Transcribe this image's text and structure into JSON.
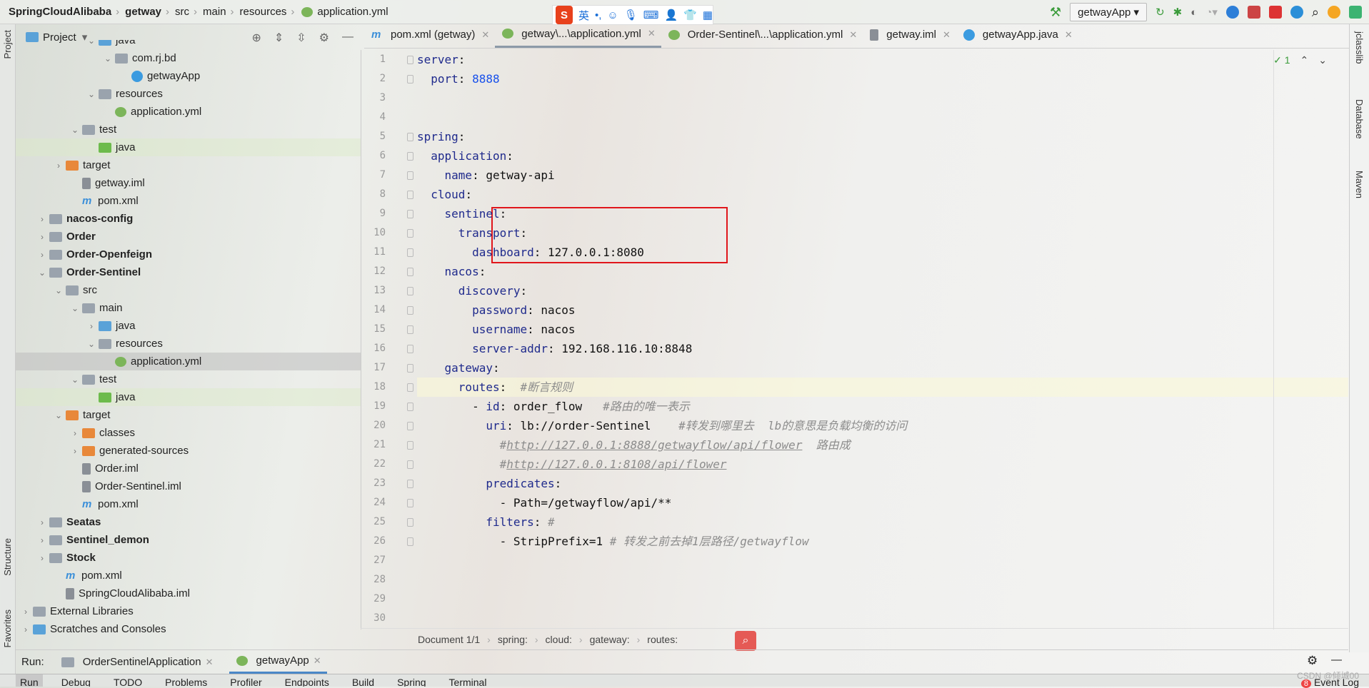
{
  "breadcrumb": [
    "SpringCloudAlibaba",
    "getway",
    "src",
    "main",
    "resources",
    "application.yml"
  ],
  "ime": {
    "logo": "S",
    "lang": "英",
    "punct": "•,"
  },
  "toolbar": {
    "run_config": "getwayApp"
  },
  "left_strip": {
    "project": "Project",
    "structure": "Structure",
    "favorites": "Favorites"
  },
  "right_strip": {
    "classlib": "jclasslib",
    "database": "Database",
    "maven": "Maven"
  },
  "project_panel": {
    "title": "Project",
    "items": [
      {
        "label": "java",
        "level": 4,
        "arrow": "open",
        "icon": "folder-blue"
      },
      {
        "label": "com.rj.bd",
        "level": 5,
        "arrow": "open",
        "icon": "folder-gray"
      },
      {
        "label": "getwayApp",
        "level": 6,
        "icon": "class"
      },
      {
        "label": "resources",
        "level": 4,
        "arrow": "open",
        "icon": "folder-gray"
      },
      {
        "label": "application.yml",
        "level": 5,
        "icon": "yml"
      },
      {
        "label": "test",
        "level": 3,
        "arrow": "open",
        "icon": "folder-gray"
      },
      {
        "label": "java",
        "level": 4,
        "icon": "folder-green",
        "state": "hl"
      },
      {
        "label": "target",
        "level": 2,
        "arrow": "closed",
        "icon": "folder-orange"
      },
      {
        "label": "getway.iml",
        "level": 3,
        "icon": "file"
      },
      {
        "label": "pom.xml",
        "level": 3,
        "icon": "maven"
      },
      {
        "label": "nacos-config",
        "level": 1,
        "arrow": "closed",
        "icon": "folder-gray",
        "bold": true
      },
      {
        "label": "Order",
        "level": 1,
        "arrow": "closed",
        "icon": "folder-gray",
        "bold": true
      },
      {
        "label": "Order-Openfeign",
        "level": 1,
        "arrow": "closed",
        "icon": "folder-gray",
        "bold": true
      },
      {
        "label": "Order-Sentinel",
        "level": 1,
        "arrow": "open",
        "icon": "folder-gray",
        "bold": true
      },
      {
        "label": "src",
        "level": 2,
        "arrow": "open",
        "icon": "folder-gray"
      },
      {
        "label": "main",
        "level": 3,
        "arrow": "open",
        "icon": "folder-gray"
      },
      {
        "label": "java",
        "level": 4,
        "arrow": "closed",
        "icon": "folder-blue"
      },
      {
        "label": "resources",
        "level": 4,
        "arrow": "open",
        "icon": "folder-gray"
      },
      {
        "label": "application.yml",
        "level": 5,
        "icon": "yml",
        "state": "sel"
      },
      {
        "label": "test",
        "level": 3,
        "arrow": "open",
        "icon": "folder-gray"
      },
      {
        "label": "java",
        "level": 4,
        "icon": "folder-green",
        "state": "hl"
      },
      {
        "label": "target",
        "level": 2,
        "arrow": "open",
        "icon": "folder-orange"
      },
      {
        "label": "classes",
        "level": 3,
        "arrow": "closed",
        "icon": "folder-orange"
      },
      {
        "label": "generated-sources",
        "level": 3,
        "arrow": "closed",
        "icon": "folder-orange"
      },
      {
        "label": "Order.iml",
        "level": 3,
        "icon": "file"
      },
      {
        "label": "Order-Sentinel.iml",
        "level": 3,
        "icon": "file"
      },
      {
        "label": "pom.xml",
        "level": 3,
        "icon": "maven"
      },
      {
        "label": "Seatas",
        "level": 1,
        "arrow": "closed",
        "icon": "folder-gray",
        "bold": true
      },
      {
        "label": "Sentinel_demon",
        "level": 1,
        "arrow": "closed",
        "icon": "folder-gray",
        "bold": true
      },
      {
        "label": "Stock",
        "level": 1,
        "arrow": "closed",
        "icon": "folder-gray",
        "bold": true
      },
      {
        "label": "pom.xml",
        "level": 2,
        "icon": "maven"
      },
      {
        "label": "SpringCloudAlibaba.iml",
        "level": 2,
        "icon": "file"
      },
      {
        "label": "External Libraries",
        "level": 0,
        "arrow": "closed",
        "icon": "libraries"
      },
      {
        "label": "Scratches and Consoles",
        "level": 0,
        "arrow": "closed",
        "icon": "scratches"
      }
    ]
  },
  "tabs": [
    {
      "label": "pom.xml (getway)",
      "icon": "maven"
    },
    {
      "label": "getway\\...\\application.yml",
      "icon": "yml",
      "active": true
    },
    {
      "label": "Order-Sentinel\\...\\application.yml",
      "icon": "yml"
    },
    {
      "label": "getway.iml",
      "icon": "file"
    },
    {
      "label": "getwayApp.java",
      "icon": "class"
    }
  ],
  "editor": {
    "inspection": "✓ 1",
    "current_line": 18,
    "lines": [
      [
        [
          "k",
          "server"
        ],
        [
          "v",
          ":"
        ]
      ],
      [
        [
          "v",
          "  "
        ],
        [
          "k",
          "port"
        ],
        [
          "v",
          ": "
        ],
        [
          "n",
          "8888"
        ]
      ],
      [],
      [],
      [
        [
          "k",
          "spring"
        ],
        [
          "v",
          ":"
        ]
      ],
      [
        [
          "v",
          "  "
        ],
        [
          "k",
          "application"
        ],
        [
          "v",
          ":"
        ]
      ],
      [
        [
          "v",
          "    "
        ],
        [
          "k",
          "name"
        ],
        [
          "v",
          ": getway-api"
        ]
      ],
      [
        [
          "v",
          "  "
        ],
        [
          "k",
          "cloud"
        ],
        [
          "v",
          ":"
        ]
      ],
      [
        [
          "v",
          "    "
        ],
        [
          "k",
          "sentinel"
        ],
        [
          "v",
          ":"
        ]
      ],
      [
        [
          "v",
          "      "
        ],
        [
          "k",
          "transport"
        ],
        [
          "v",
          ":"
        ]
      ],
      [
        [
          "v",
          "        "
        ],
        [
          "k",
          "dashboard"
        ],
        [
          "v",
          ": 127.0.0.1:8080"
        ]
      ],
      [
        [
          "v",
          "    "
        ],
        [
          "k",
          "nacos"
        ],
        [
          "v",
          ":"
        ]
      ],
      [
        [
          "v",
          "      "
        ],
        [
          "k",
          "discovery"
        ],
        [
          "v",
          ":"
        ]
      ],
      [
        [
          "v",
          "        "
        ],
        [
          "k",
          "password"
        ],
        [
          "v",
          ": nacos"
        ]
      ],
      [
        [
          "v",
          "        "
        ],
        [
          "k",
          "username"
        ],
        [
          "v",
          ": nacos"
        ]
      ],
      [
        [
          "v",
          "        "
        ],
        [
          "k",
          "server-addr"
        ],
        [
          "v",
          ": 192.168.116.10:8848"
        ]
      ],
      [
        [
          "v",
          "    "
        ],
        [
          "k",
          "gateway"
        ],
        [
          "v",
          ":"
        ]
      ],
      [
        [
          "v",
          "      "
        ],
        [
          "k",
          "routes"
        ],
        [
          "v",
          ":  "
        ],
        [
          "c",
          "#断言规则"
        ]
      ],
      [
        [
          "v",
          "        - "
        ],
        [
          "k",
          "id"
        ],
        [
          "v",
          ": order_flow   "
        ],
        [
          "c",
          "#路由的唯一表示"
        ]
      ],
      [
        [
          "v",
          "          "
        ],
        [
          "k",
          "uri"
        ],
        [
          "v",
          ": lb://order-Sentinel    "
        ],
        [
          "c",
          "#转发到哪里去  lb的意思是负载均衡的访问"
        ]
      ],
      [
        [
          "v",
          "            "
        ],
        [
          "c",
          "#"
        ],
        [
          "u",
          "http://127.0.0.1:8888/getwayflow/api/flower"
        ],
        [
          "c",
          "  路由成"
        ]
      ],
      [
        [
          "v",
          "            "
        ],
        [
          "c",
          "#"
        ],
        [
          "u",
          "http://127.0.0.1:8108/api/flower"
        ]
      ],
      [
        [
          "v",
          "          "
        ],
        [
          "k",
          "predicates"
        ],
        [
          "v",
          ":"
        ]
      ],
      [
        [
          "v",
          "            - Path=/getwayflow/api/**"
        ]
      ],
      [
        [
          "v",
          "          "
        ],
        [
          "k",
          "filters"
        ],
        [
          "v",
          ": "
        ],
        [
          "c",
          "#"
        ]
      ],
      [
        [
          "v",
          "            - StripPrefix=1 "
        ],
        [
          "c",
          "# 转发之前去掉1层路径/getwayflow"
        ]
      ],
      [],
      [],
      [],
      []
    ]
  },
  "status_breadcrumb": [
    "Document 1/1",
    "spring:",
    "cloud:",
    "gateway:",
    "routes:"
  ],
  "run": {
    "label": "Run:",
    "tabs": [
      {
        "label": "OrderSentinelApplication"
      },
      {
        "label": "getwayApp",
        "active": true
      }
    ]
  },
  "bottom_tools": [
    "Run",
    "Debug",
    "TODO",
    "Problems",
    "Profiler",
    "Endpoints",
    "Build",
    "Spring",
    "Terminal"
  ],
  "event_log": {
    "count": "8",
    "label": "Event Log"
  },
  "watermark": "CSDN @倾城00",
  "colors": {
    "highlight_box": "#e0161b",
    "key": "#1f2a8c",
    "number": "#1750eb",
    "comment": "#8c8c8c"
  }
}
